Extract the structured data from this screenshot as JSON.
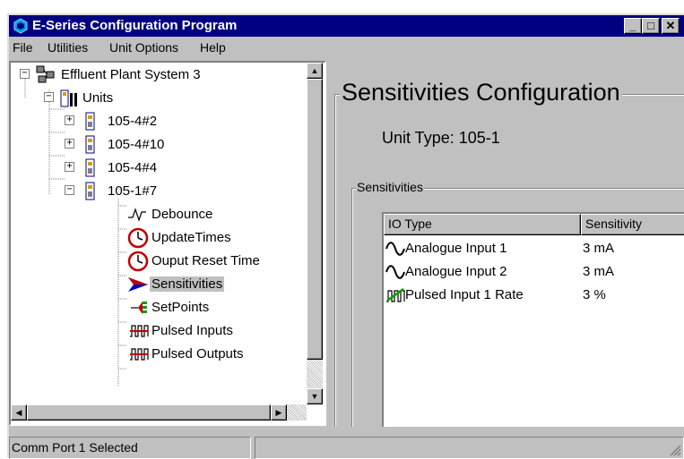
{
  "window": {
    "title": "E-Series Configuration Program",
    "minimize_label": "_",
    "maximize_label": "□",
    "close_label": "✕"
  },
  "menu": {
    "items": [
      "File",
      "Utilities",
      "Unit Options",
      "Help"
    ]
  },
  "tree": {
    "root": "Effluent Plant System 3",
    "units_label": "Units",
    "units": [
      {
        "label": "105-4#2",
        "expander": "+"
      },
      {
        "label": "105-4#10",
        "expander": "+"
      },
      {
        "label": "105-4#4",
        "expander": "+"
      },
      {
        "label": "105-1#7",
        "expander": "−"
      }
    ],
    "children": [
      {
        "label": "Debounce",
        "icon": "debounce-icon"
      },
      {
        "label": "UpdateTimes",
        "icon": "clock-icon"
      },
      {
        "label": "Ouput Reset Time",
        "icon": "clock-icon"
      },
      {
        "label": "Sensitivities",
        "icon": "sensitivity-arrow-icon",
        "selected": true
      },
      {
        "label": "SetPoints",
        "icon": "setpoints-icon"
      },
      {
        "label": "Pulsed Inputs",
        "icon": "pulse-icon"
      },
      {
        "label": "Pulsed Outputs",
        "icon": "pulse-icon"
      }
    ]
  },
  "config": {
    "title": "Sensitivities Configuration",
    "unit_type": "Unit Type: 105-1",
    "group_label": "Sensitivities",
    "columns": [
      "IO Type",
      "Sensitivity"
    ],
    "rows": [
      {
        "io_type": "Analogue Input 1",
        "sensitivity": "3 mA",
        "icon": "analogue-wave-icon"
      },
      {
        "io_type": "Analogue Input 2",
        "sensitivity": "3 mA",
        "icon": "analogue-wave-icon"
      },
      {
        "io_type": "Pulsed Input 1 Rate",
        "sensitivity": "3 %",
        "icon": "pulse-rate-icon"
      }
    ]
  },
  "status": {
    "text": "Comm Port 1 Selected"
  },
  "colors": {
    "titlebar": "#000080",
    "face": "#c0c0c0",
    "selection": "#c0c0c0"
  }
}
